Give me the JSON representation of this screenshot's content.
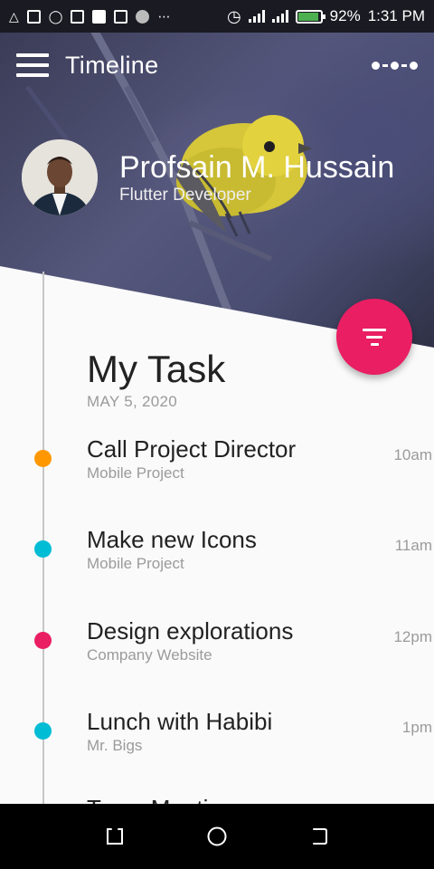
{
  "status_bar": {
    "battery": "92%",
    "time": "1:31 PM",
    "battery_level": 0.92,
    "notification_icons": [
      "warning-icon",
      "news-icon",
      "shield-icon",
      "image-icon",
      "square-icon",
      "gmail-icon",
      "circle-icon",
      "more-dots-icon"
    ],
    "system_icons": [
      "alarm-icon",
      "signal-icon",
      "signal-icon",
      "battery-icon"
    ]
  },
  "appbar": {
    "title": "Timeline",
    "menu_icon": "hamburger-menu-icon",
    "more_icon": "more-horizontal-icon"
  },
  "profile": {
    "name": "Profsain M. Hussain",
    "role": "Flutter Developer"
  },
  "fab": {
    "icon": "filter-list-icon",
    "color": "#e91e63"
  },
  "section": {
    "title": "My Task",
    "date": "MAY 5, 2020"
  },
  "tasks": [
    {
      "title": "Call Project Director",
      "subtitle": "Mobile Project",
      "time": "10am",
      "color": "#ff9800"
    },
    {
      "title": "Make new Icons",
      "subtitle": "Mobile Project",
      "time": "11am",
      "color": "#00bcd4"
    },
    {
      "title": "Design explorations",
      "subtitle": "Company Website",
      "time": "12pm",
      "color": "#e91e63"
    },
    {
      "title": "Lunch with Habibi",
      "subtitle": "Mr. Bigs",
      "time": "1pm",
      "color": "#00bcd4"
    }
  ],
  "peek_task": {
    "title": "Team Meeting"
  },
  "navbar": {
    "icons": [
      "recents-icon",
      "home-icon",
      "back-icon"
    ]
  },
  "colors": {
    "accent": "#e91e63",
    "header_bg": "#4a4e72",
    "timeline_line": "#c6c6c6"
  }
}
